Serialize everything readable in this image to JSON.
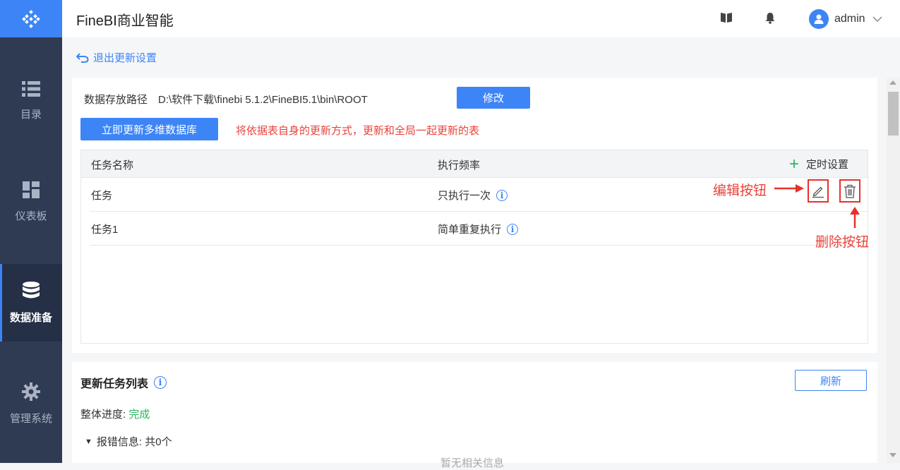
{
  "app": {
    "title": "FineBI商业智能"
  },
  "sidebar": {
    "items": [
      {
        "label": "目录",
        "icon": "list-icon"
      },
      {
        "label": "仪表板",
        "icon": "dashboard-icon"
      },
      {
        "label": "数据准备",
        "icon": "database-icon",
        "active": true
      },
      {
        "label": "管理系统",
        "icon": "gear-icon"
      }
    ]
  },
  "header": {
    "username": "admin"
  },
  "back": {
    "label": "退出更新设置"
  },
  "storage": {
    "label": "数据存放路径",
    "path": "D:\\软件下载\\finebi 5.1.2\\FineBI5.1\\bin\\ROOT",
    "modify_label": "修改"
  },
  "update_now": {
    "button_label": "立即更新多维数据库",
    "note": "将依据表自身的更新方式，更新和全局一起更新的表"
  },
  "task_table": {
    "columns": {
      "name": "任务名称",
      "frequency": "执行频率",
      "timer": "定时设置"
    },
    "rows": [
      {
        "name": "任务",
        "frequency": "只执行一次"
      },
      {
        "name": "任务1",
        "frequency": "简单重复执行"
      }
    ]
  },
  "annotations": {
    "edit": "编辑按钮",
    "delete": "删除按钮"
  },
  "update_list": {
    "title": "更新任务列表",
    "refresh_label": "刷新",
    "progress_label": "整体进度:",
    "progress_value": "完成",
    "error_info": "报错信息: 共0个",
    "empty_text": "暂无相关信息"
  },
  "colors": {
    "accent": "#3d85f7",
    "sidebar_bg": "#2f3b52",
    "annotation_red": "#e8433a",
    "success_green": "#2db55d"
  }
}
